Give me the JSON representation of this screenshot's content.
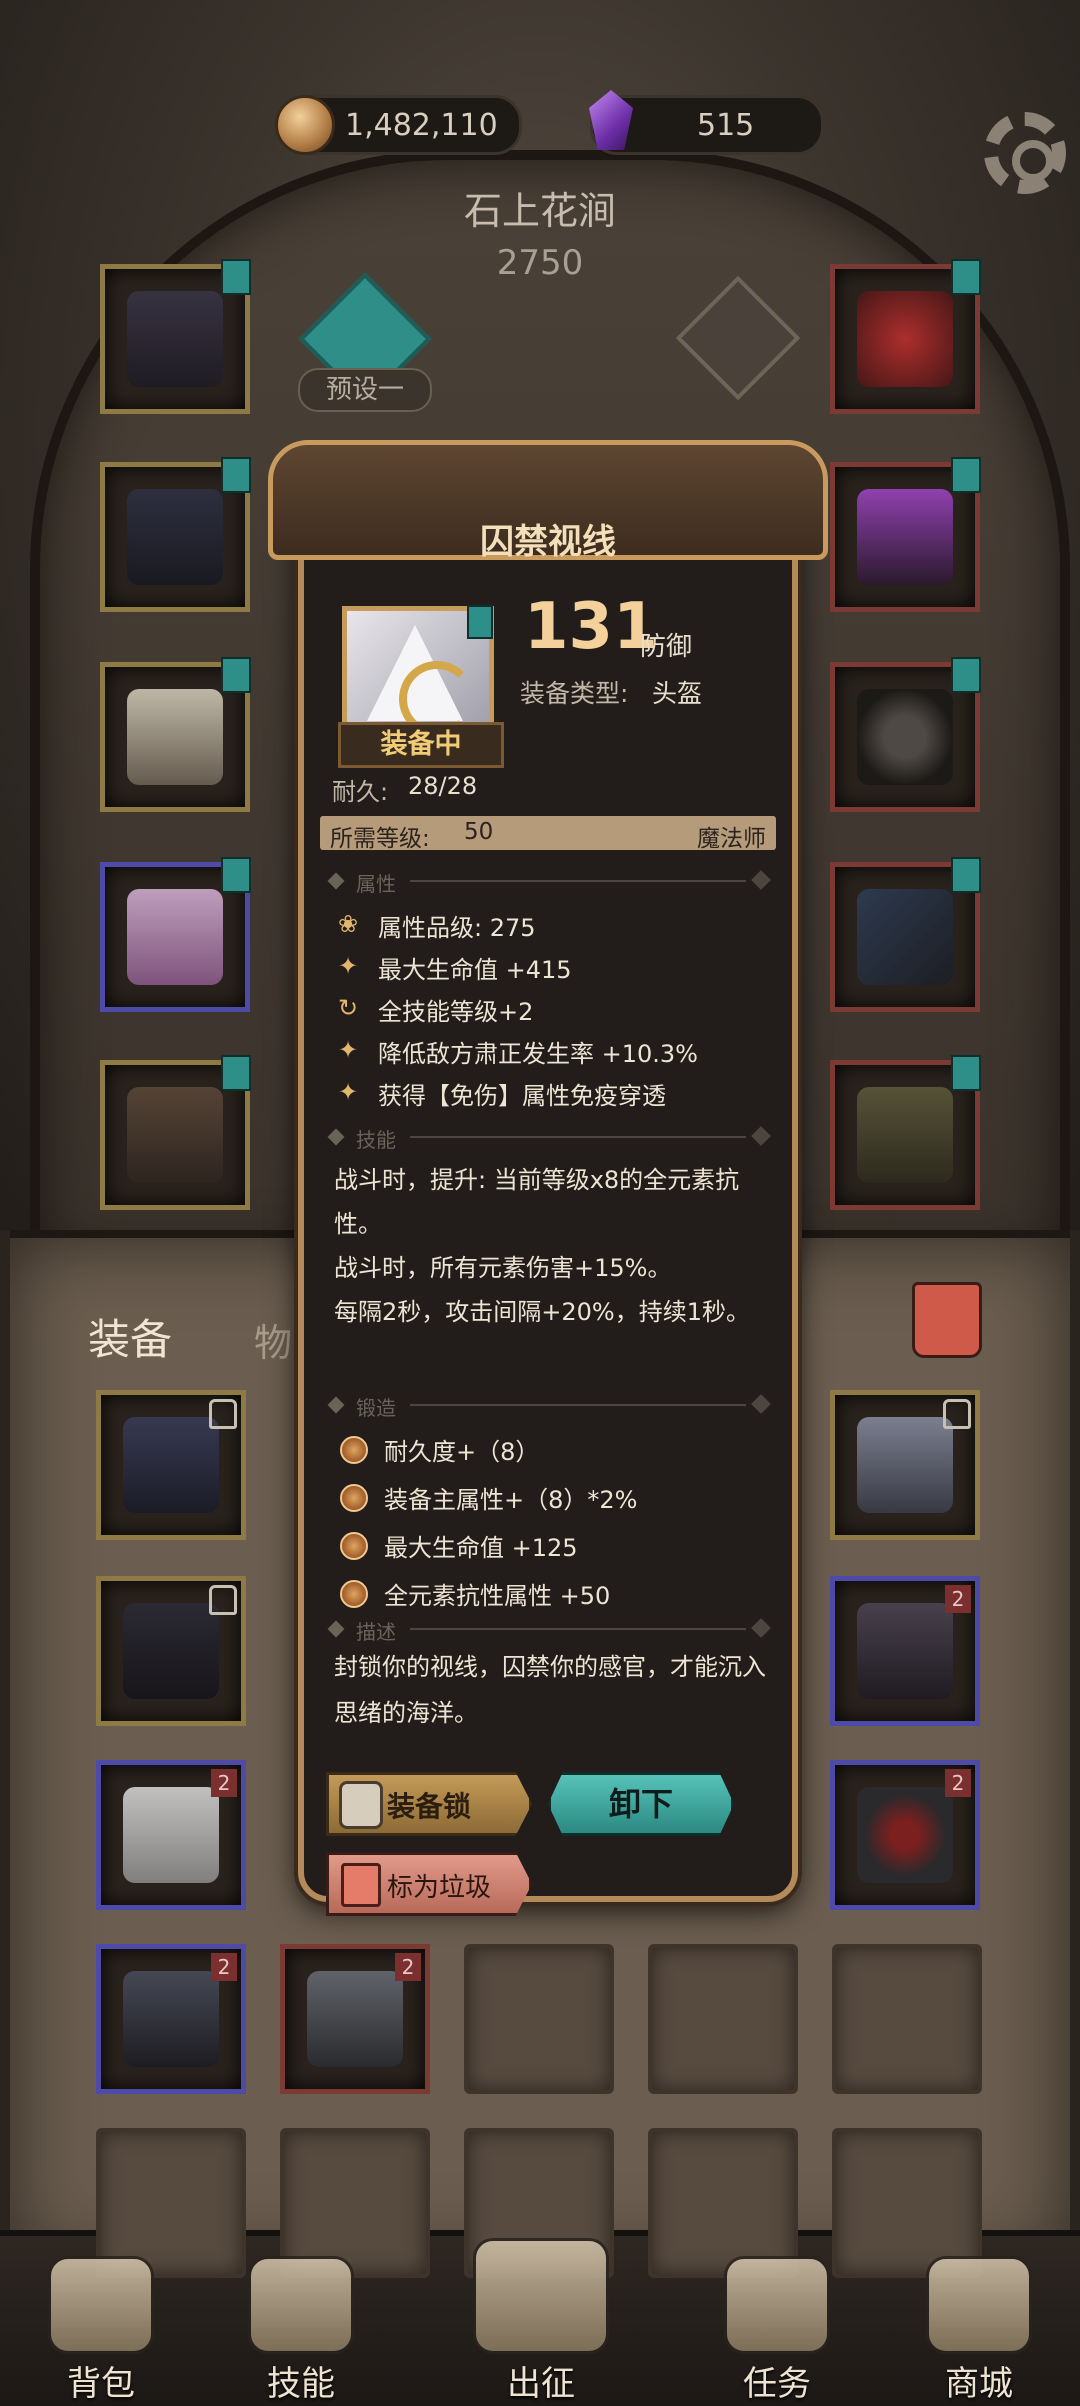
{
  "currency": {
    "coins": "1,482,110",
    "gems": "515"
  },
  "character": {
    "name": "石上花涧",
    "power": "2750",
    "preset_label": "预设一"
  },
  "tabs": {
    "equipment": "装备",
    "items": "物品"
  },
  "nav": [
    {
      "label": "背包",
      "icon": "backpack-icon"
    },
    {
      "label": "技能",
      "icon": "skill-book-icon"
    },
    {
      "label": "出征",
      "icon": "battle-icon"
    },
    {
      "label": "任务",
      "icon": "quest-scroll-icon"
    },
    {
      "label": "商城",
      "icon": "shop-icon"
    }
  ],
  "slot_badges": {
    "tier": "2"
  },
  "popup": {
    "title": "囚禁视线",
    "defense_value": "131",
    "defense_label": "防御",
    "type_label": "装备类型:",
    "type_value": "头盔",
    "equipped_label": "装备中",
    "durability_label": "耐久:",
    "durability_value": "28/28",
    "required_level_label": "所需等级:",
    "required_level_value": "50",
    "required_class": "魔法师",
    "sections": {
      "attributes": "属性",
      "skills": "技能",
      "forge": "锻造",
      "description": "描述"
    },
    "attributes": [
      "属性品级: 275",
      "最大生命值 +415",
      "全技能等级+2",
      "降低敌方肃正发生率 +10.3%",
      "获得【免伤】属性免疫穿透"
    ],
    "skills": [
      "战斗时，提升: 当前等级x8的全元素抗性。",
      "战斗时，所有元素伤害+15%。",
      "每隔2秒，攻击间隔+20%，持续1秒。"
    ],
    "forge": [
      "耐久度+（8）",
      "装备主属性+（8）*2%",
      "最大生命值 +125",
      "全元素抗性属性 +50"
    ],
    "description": "封锁你的视线，囚禁你的感官，才能沉入思绪的海洋。",
    "buttons": {
      "lock": "装备锁",
      "unequip": "卸下",
      "trash": "标为垃圾"
    }
  }
}
